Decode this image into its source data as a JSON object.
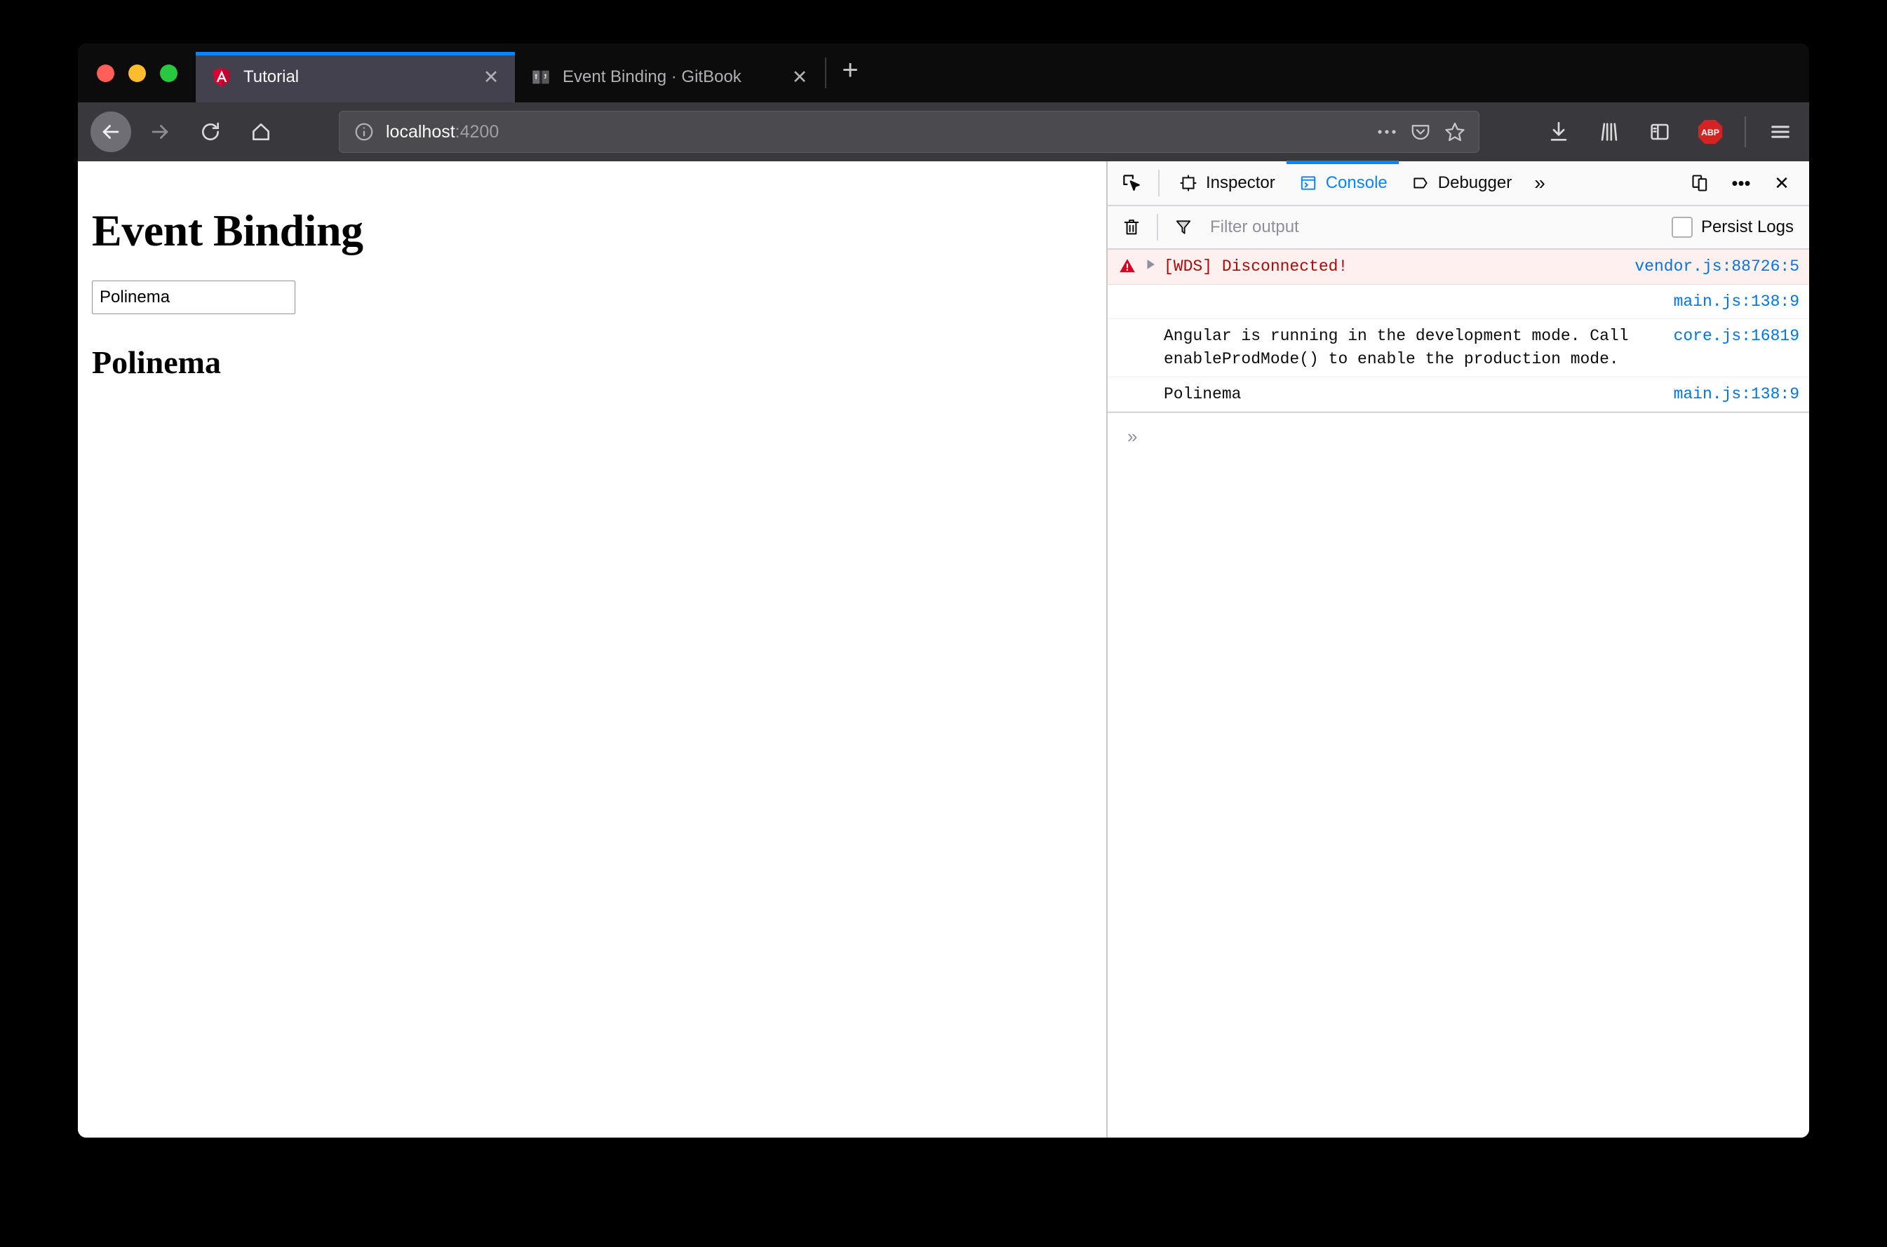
{
  "window": {
    "traffic_lights": [
      {
        "name": "close",
        "color": "#ff5f57"
      },
      {
        "name": "minimize",
        "color": "#febc2e"
      },
      {
        "name": "zoom",
        "color": "#28c840"
      }
    ]
  },
  "tabs": [
    {
      "title": "Tutorial",
      "favicon": "angular-icon",
      "active": true,
      "close_label": "✕"
    },
    {
      "title": "Event Binding · GitBook",
      "favicon": "gitbook-icon",
      "active": false,
      "close_label": "✕"
    }
  ],
  "newtab_label": "+",
  "navbar": {
    "back_icon": "back-arrow-icon",
    "forward_icon": "forward-arrow-icon",
    "reload_icon": "reload-icon",
    "home_icon": "home-icon",
    "url_host": "localhost",
    "url_port": ":4200",
    "url_full": "localhost:4200",
    "identity_icon": "info-circle-icon",
    "page_actions_icon": "ellipsis-icon",
    "pocket_icon": "pocket-icon",
    "bookmark_icon": "star-icon",
    "right_icons": [
      {
        "name": "downloads-icon"
      },
      {
        "name": "library-icon"
      },
      {
        "name": "sidebar-icon"
      },
      {
        "name": "adblock-plus-icon",
        "label": "ABP",
        "color": "#d32323"
      },
      {
        "name": "hamburger-menu-icon"
      }
    ]
  },
  "page": {
    "heading": "Event Binding",
    "input_value": "Polinema",
    "input_placeholder": "",
    "output_heading": "Polinema"
  },
  "devtools": {
    "picker_icon": "element-picker-icon",
    "tabs": [
      {
        "label": "Inspector",
        "icon": "inspector-icon",
        "active": false
      },
      {
        "label": "Console",
        "icon": "console-icon",
        "active": true
      },
      {
        "label": "Debugger",
        "icon": "debugger-icon",
        "active": false
      }
    ],
    "overflow_label": "»",
    "responsive_icon": "responsive-design-mode-icon",
    "meatball_label": "•••",
    "close_label": "✕",
    "filterbar": {
      "trash_icon": "clear-console-icon",
      "funnel_icon": "filter-icon",
      "filter_placeholder": "Filter output",
      "persist_label": "Persist Logs",
      "persist_checked": false
    },
    "messages": [
      {
        "level": "error",
        "icon": "error-triangle-icon",
        "expandable": true,
        "text": "[WDS] Disconnected!",
        "source": "vendor.js:88726:5"
      },
      {
        "level": "log",
        "icon": "",
        "expandable": false,
        "text": "",
        "source": "main.js:138:9"
      },
      {
        "level": "log",
        "icon": "",
        "expandable": false,
        "text": "Angular is running in the development mode. Call\nenableProdMode() to enable the production mode.",
        "source": "core.js:16819"
      },
      {
        "level": "log",
        "icon": "",
        "expandable": false,
        "text": "Polinema",
        "source": "main.js:138:9"
      }
    ],
    "prompt_chevron": "»"
  }
}
